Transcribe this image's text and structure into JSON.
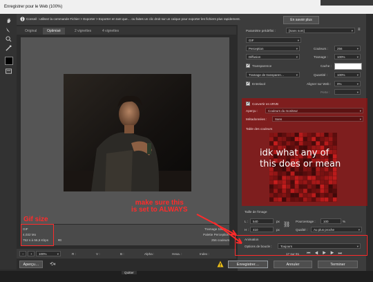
{
  "window": {
    "title": "Enregistrer pour le Web (100%)"
  },
  "hint": {
    "text": "Conseil : utilisez la commande Fichier > Exporter > Exporter en tant que… ou faites un clic droit sur un calque pour exporter les fichiers plus rapidement.",
    "learn_more": "En savoir plus"
  },
  "tabs": [
    "Original",
    "Optimisé",
    "2 vignettes",
    "4 vignettes"
  ],
  "preview_info": {
    "format": "GIF",
    "size": "4,032 Mo",
    "time": "752 s à 56,6 Kbps",
    "dither": "Tramage 100%",
    "palette": "Palette Perception",
    "colors": "256 couleurs"
  },
  "statusbar": {
    "zoom": "100%",
    "r_label": "R :",
    "v_label": "V :",
    "b_label": "B :",
    "alpha_label": "Alpha :",
    "hex_label": "Hexa. :",
    "index_label": "Index :"
  },
  "settings": {
    "preset_label": "Paramètre prédéfini :",
    "preset_value": "[Sans nom]",
    "format": "GIF",
    "reduction": "Perception",
    "colors_label": "Couleurs :",
    "colors_value": "256",
    "dither_algo": "Diffusion",
    "dither_label": "Tramage :",
    "dither_value": "100%",
    "transparency_label": "Transparence",
    "matte_label": "Cache :",
    "transp_dither": "Tramage de transparen…",
    "amount_label": "Quantité :",
    "amount_value": "100%",
    "interlaced_label": "Entrelacé",
    "websnap_label": "Aligner sur Web :",
    "websnap_value": "0%",
    "lossy_label": "Perte :"
  },
  "color_section": {
    "convert_label": "Convertir en sRVB",
    "preview_label": "Aperçu :",
    "preview_value": "Couleurs du moniteur",
    "metadata_label": "Métadonnées :",
    "metadata_value": "Sans",
    "table_label": "Table des couleurs",
    "swatch_count": "256"
  },
  "image_size": {
    "title": "Taille de l'image",
    "w_label": "L :",
    "w_value": "540",
    "h_label": "H :",
    "h_value": "410",
    "unit": "px",
    "percent_label": "Pourcentage :",
    "percent_value": "100",
    "percent_unit": "%",
    "quality_label": "Qualité :",
    "quality_value": "Au plus proche"
  },
  "animation": {
    "title": "Animation",
    "loop_label": "Options de boucle :",
    "loop_value": "Toujours",
    "frame_counter": "17 sur 91"
  },
  "buttons": {
    "preview": "Aperçu…",
    "save": "Enregistrer…",
    "cancel": "Annuler",
    "done": "Terminer"
  },
  "annotations": {
    "gif_size": "Gif size",
    "always_note_line1": "make sure this",
    "always_note_line2": "is set to ALWAYS",
    "idk_line1": "idk what any of",
    "idk_line2": "this does or mean"
  },
  "taskbar": {
    "quit_label": "Quitter"
  },
  "colors": {
    "accent_red": "#ff2b2b",
    "overlay_red": "#aa0a0a"
  }
}
